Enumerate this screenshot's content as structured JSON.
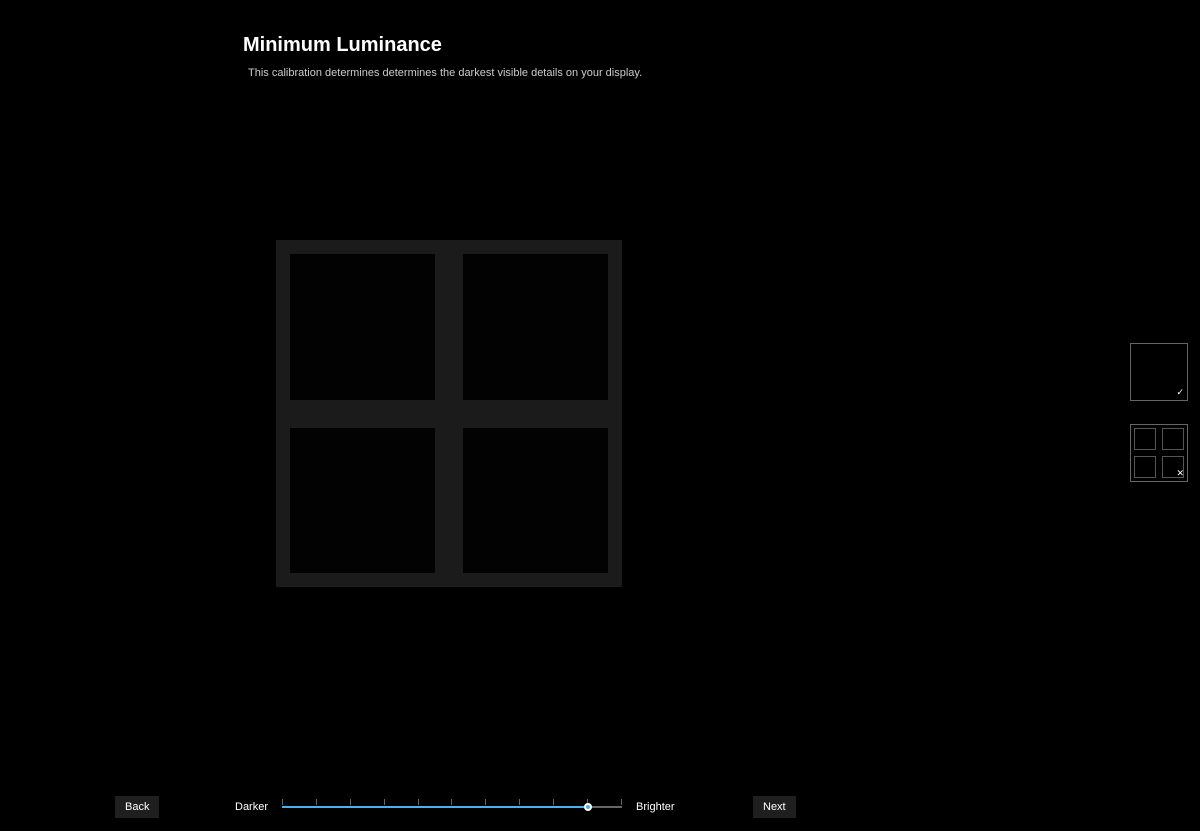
{
  "header": {
    "title": "Minimum Luminance",
    "subtitle": "This calibration determines determines the darkest visible details on your display."
  },
  "slider": {
    "left_label": "Darker",
    "right_label": "Brighter",
    "value_percent": 90,
    "ticks": 11
  },
  "buttons": {
    "back": "Back",
    "next": "Next"
  },
  "reference": {
    "correct_icon": "✓",
    "wrong_icon": "✕"
  }
}
